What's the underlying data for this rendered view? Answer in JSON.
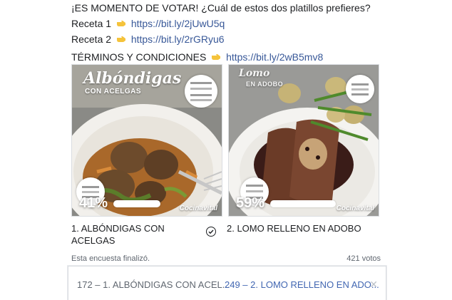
{
  "post": {
    "line1": "¡ES MOMENTO DE VOTAR! ¿Cuál de estos dos platillos prefieres?",
    "receta1_label": "Receta 1",
    "receta1_url": "https://bit.ly/2jUwU5q",
    "receta2_label": "Receta 2",
    "receta2_url": "https://bit.ly/2rGRyu6",
    "terms_label": "TÉRMINOS Y CONDICIONES",
    "terms_url": "https://bit.ly/2wB5mv8",
    "emoji_icon": "pointing-right-hand-icon"
  },
  "poll": {
    "options": [
      {
        "title": "Albóndigas",
        "subtitle": "CON ACELGAS",
        "percent": "41%",
        "percent_value": 41,
        "brand": "Cocinavital",
        "label": "1. ALBÓNDIGAS CON ACELGAS",
        "selected": false
      },
      {
        "title": "Lomo",
        "subtitle": "EN ADOBO",
        "percent": "59%",
        "percent_value": 59,
        "brand": "Cocinavital",
        "label": "2. LOMO RELLENO EN ADOBO",
        "selected": true
      }
    ],
    "status": "Esta encuesta finalizó.",
    "votes": "421 votos"
  },
  "results": {
    "r1": "172 – 1. ALBÓNDIGAS CON ACEL...",
    "r2": "249 – 2. LOMO RELLENO EN ADO...",
    "close_icon": "close-icon"
  },
  "colors": {
    "link": "#385898",
    "result_highlight": "#4267b2",
    "muted": "#606770"
  }
}
